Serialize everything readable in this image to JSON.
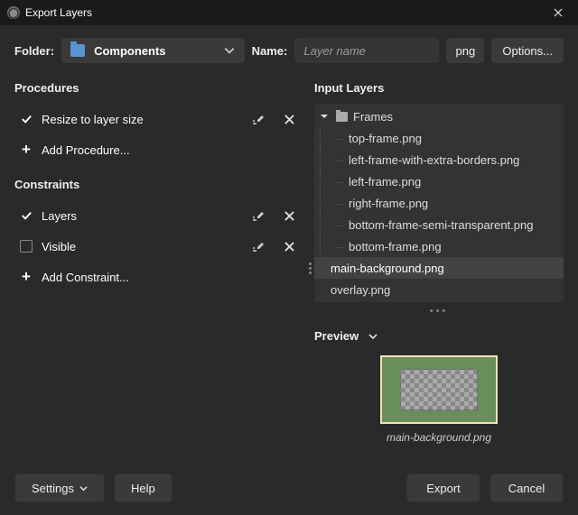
{
  "window": {
    "title": "Export Layers"
  },
  "top": {
    "folder_label": "Folder:",
    "folder_value": "Components",
    "name_label": "Name:",
    "name_placeholder": "Layer name",
    "ext": "png",
    "options_btn": "Options..."
  },
  "procedures": {
    "title": "Procedures",
    "items": [
      {
        "label": "Resize to layer size",
        "checked": true
      }
    ],
    "add_label": "Add Procedure..."
  },
  "constraints": {
    "title": "Constraints",
    "items": [
      {
        "label": "Layers",
        "checked": true
      },
      {
        "label": "Visible",
        "checked": false
      }
    ],
    "add_label": "Add Constraint..."
  },
  "input_layers": {
    "title": "Input Layers",
    "folder": "Frames",
    "children": [
      "top-frame.png",
      "left-frame-with-extra-borders.png",
      "left-frame.png",
      "right-frame.png",
      "bottom-frame-semi-transparent.png",
      "bottom-frame.png"
    ],
    "selected": "main-background.png",
    "after": "overlay.png"
  },
  "preview": {
    "title": "Preview",
    "caption": "main-background.png"
  },
  "footer": {
    "settings": "Settings",
    "help": "Help",
    "export": "Export",
    "cancel": "Cancel"
  }
}
